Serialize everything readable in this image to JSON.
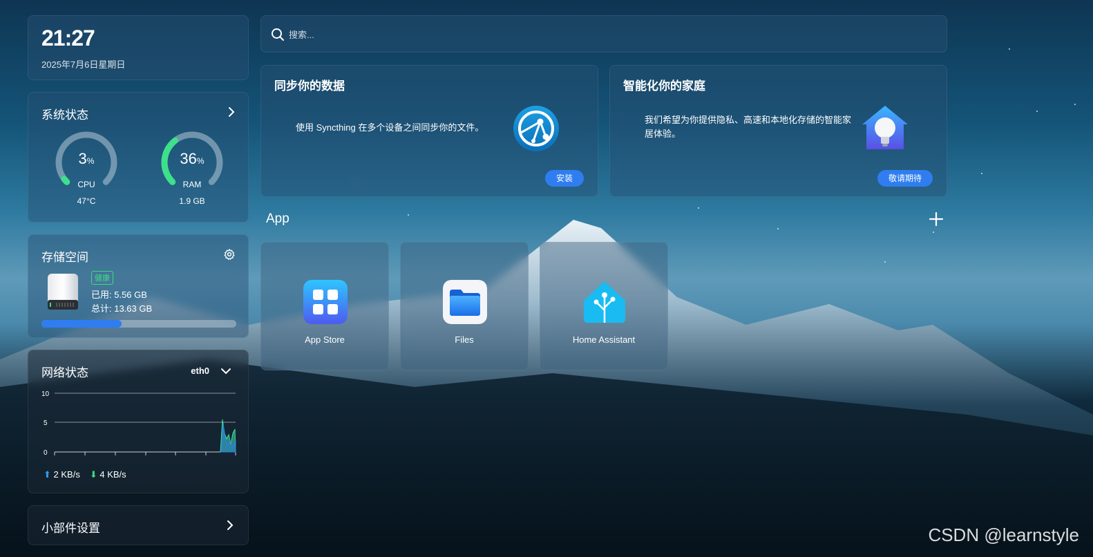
{
  "clock": {
    "time": "21:27",
    "date": "2025年7月6日星期日"
  },
  "system": {
    "title": "系统状态",
    "cpu": {
      "value": "3",
      "unit": "%",
      "label": "CPU",
      "sub": "47°C",
      "percent": 3
    },
    "ram": {
      "value": "36",
      "unit": "%",
      "label": "RAM",
      "sub": "1.9 GB",
      "percent": 36
    }
  },
  "storage": {
    "title": "存储空间",
    "health": "健康",
    "used": "已用: 5.56 GB",
    "total": "总计: 13.63 GB",
    "used_fraction": 0.41
  },
  "network": {
    "title": "网络状态",
    "interface": "eth0",
    "y_ticks": [
      "10",
      "5",
      "0"
    ],
    "upload": "2 KB/s",
    "download": "4 KB/s"
  },
  "widgets": {
    "title": "小部件设置"
  },
  "search": {
    "placeholder": "搜索..."
  },
  "promos": [
    {
      "title": "同步你的数据",
      "desc": "使用 Syncthing 在多个设备之间同步你的文件。",
      "button": "安装"
    },
    {
      "title": "智能化你的家庭",
      "desc": "我们希望为你提供隐私、高速和本地化存储的智能家居体验。",
      "button": "敬请期待"
    }
  ],
  "apps": {
    "heading": "App",
    "items": [
      {
        "name": "App Store",
        "icon": "app-store-icon"
      },
      {
        "name": "Files",
        "icon": "folder-icon"
      },
      {
        "name": "Home Assistant",
        "icon": "home-assistant-icon"
      }
    ]
  },
  "watermark": "CSDN @learnstyle",
  "colors": {
    "accent": "#2f7df0",
    "gauge_green": "#3ee08a",
    "health_green": "#3ddc84"
  }
}
